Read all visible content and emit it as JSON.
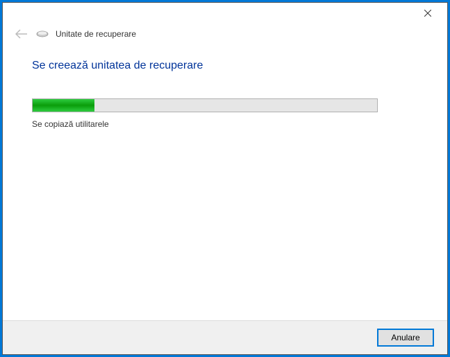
{
  "window": {
    "title": "Unitate de recuperare"
  },
  "main": {
    "heading": "Se creează unitatea de recuperare",
    "status": "Se copiază utilitarele",
    "progress_percent": 18
  },
  "footer": {
    "cancel_label": "Anulare"
  }
}
